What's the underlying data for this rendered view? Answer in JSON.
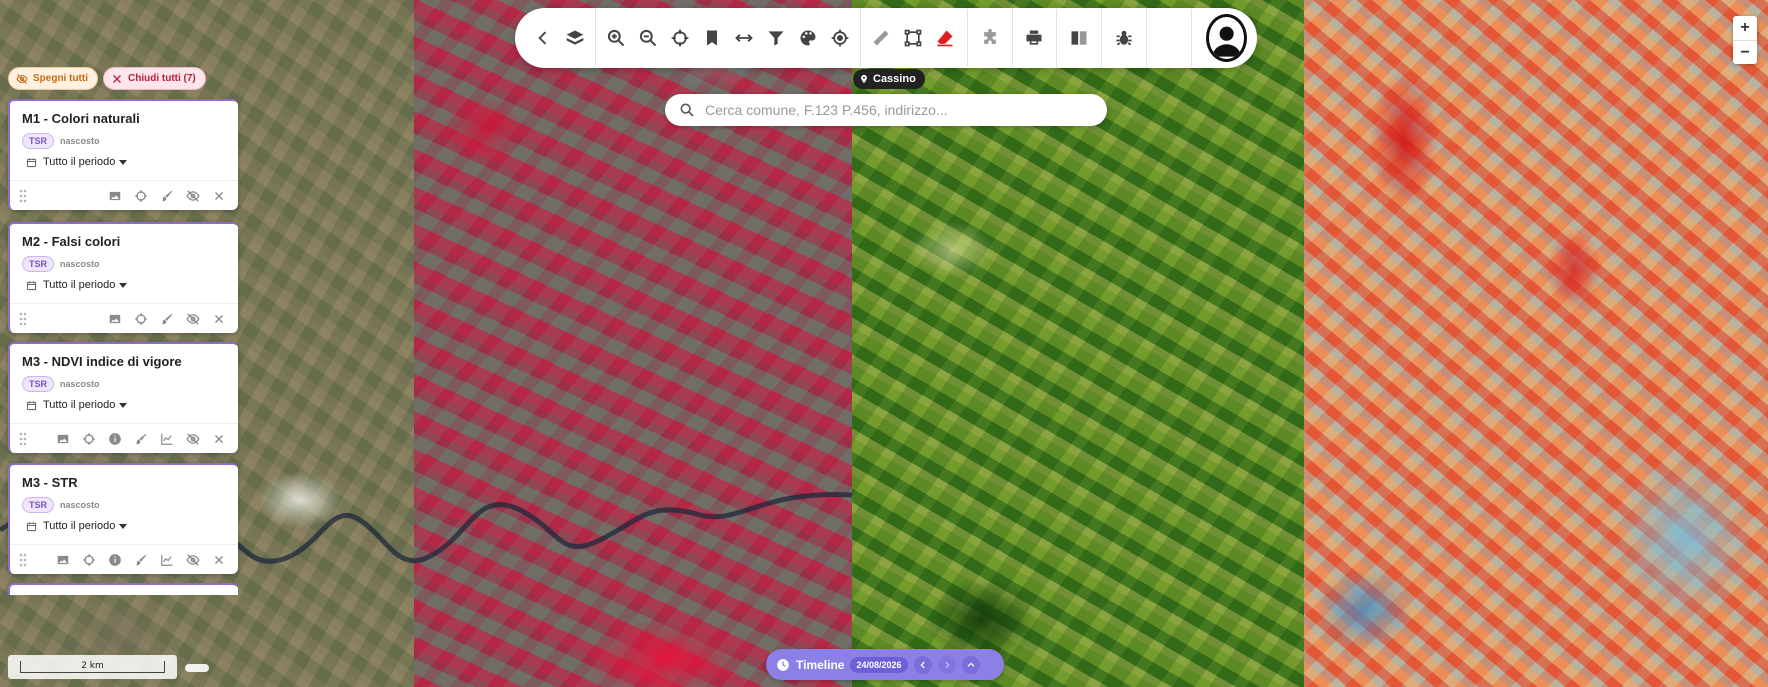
{
  "map": {
    "panes": [
      {
        "id": "natural",
        "layer": "M1 - Colori naturali"
      },
      {
        "id": "false",
        "layer": "M2 - Falsi colori"
      },
      {
        "id": "ndvi",
        "layer": "M3 - NDVI indice di vigore"
      },
      {
        "id": "str",
        "layer": "M3 - STR"
      }
    ],
    "location_label": "Cassino",
    "zoom": {
      "in_label": "+",
      "out_label": "−"
    },
    "scale_label": "2 km"
  },
  "search": {
    "placeholder": "Cerca comune, F.123 P.456, indirizzo..."
  },
  "toolbar": {
    "icons": [
      "chevron-left-icon",
      "layers-icon",
      "zoom-in-icon",
      "zoom-out-icon",
      "crosshair-icon",
      "bookmark-icon",
      "swap-horizontal-icon",
      "filter-icon",
      "palette-icon",
      "locate-icon",
      "ruler-icon",
      "square-select-icon",
      "eraser-icon",
      "puzzle-icon",
      "printer-icon",
      "book-icon",
      "bug-icon",
      "moon-icon",
      "user-avatar"
    ],
    "accent_red": "#e02020"
  },
  "layer_panel": {
    "hide_all_label": "Spegni tutti",
    "close_all_label": "Chiudi tutti (7)",
    "accent": "#8f6bd0",
    "cards": [
      {
        "title": "M1 - Colori naturali",
        "badge": "TSR",
        "status": "nascosto",
        "period": "Tutto il periodo"
      },
      {
        "title": "M2 - Falsi colori",
        "badge": "TSR",
        "status": "nascosto",
        "period": "Tutto il periodo"
      },
      {
        "title": "M3 - NDVI indice di vigore",
        "badge": "TSR",
        "status": "nascosto",
        "period": "Tutto il periodo"
      },
      {
        "title": "M3 - STR",
        "badge": "TSR",
        "status": "nascosto",
        "period": "Tutto il periodo"
      }
    ]
  },
  "timeline": {
    "label": "Timeline",
    "date": "24/08/2026",
    "color": "#8c7fe6"
  }
}
